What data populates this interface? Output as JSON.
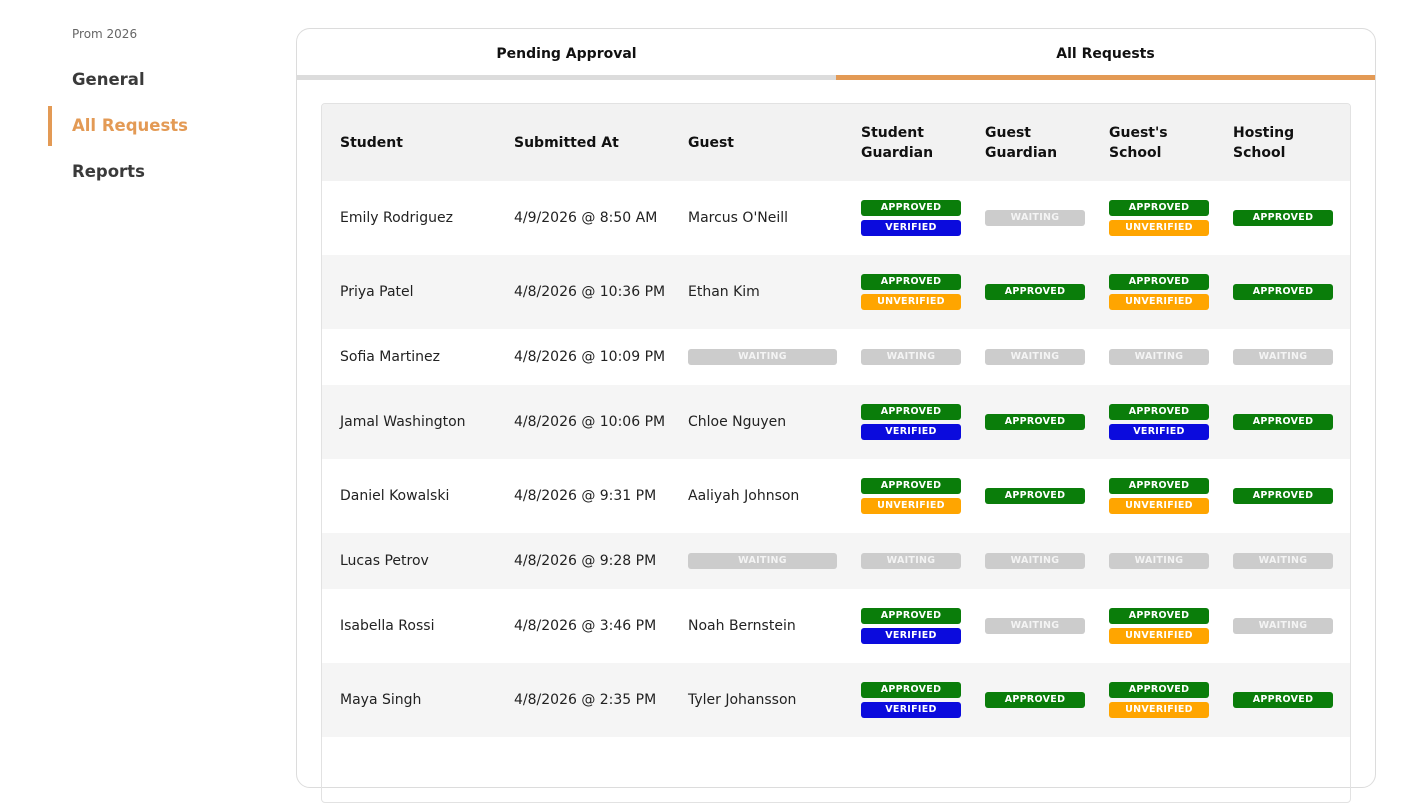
{
  "sidebar": {
    "event_name": "Prom 2026",
    "items": [
      {
        "label": "General",
        "active": false
      },
      {
        "label": "All Requests",
        "active": true
      },
      {
        "label": "Reports",
        "active": false
      }
    ]
  },
  "tabs": [
    {
      "label": "Pending Approval",
      "active": false
    },
    {
      "label": "All Requests",
      "active": true
    }
  ],
  "colors": {
    "accent": "#e39a55",
    "approved": "#0a7d0a",
    "waiting": "#cccccc",
    "verified": "#0b0bdd",
    "unverified": "#ffa500"
  },
  "table": {
    "headers": [
      "Student",
      "Submitted At",
      "Guest",
      "Student Guardian",
      "Guest Guardian",
      "Guest's School",
      "Hosting School"
    ],
    "rows": [
      {
        "student": "Emily Rodriguez",
        "submitted_at": "4/9/2026 @ 8:50 AM",
        "guest": "Marcus O'Neill",
        "student_guardian": [
          "APPROVED",
          "VERIFIED"
        ],
        "guest_guardian": [
          "WAITING"
        ],
        "guests_school": [
          "APPROVED",
          "UNVERIFIED"
        ],
        "hosting_school": [
          "APPROVED"
        ]
      },
      {
        "student": "Priya Patel",
        "submitted_at": "4/8/2026 @ 10:36 PM",
        "guest": "Ethan Kim",
        "student_guardian": [
          "APPROVED",
          "UNVERIFIED"
        ],
        "guest_guardian": [
          "APPROVED"
        ],
        "guests_school": [
          "APPROVED",
          "UNVERIFIED"
        ],
        "hosting_school": [
          "APPROVED"
        ]
      },
      {
        "student": "Sofia Martinez",
        "submitted_at": "4/8/2026 @ 10:09 PM",
        "guest": "WAITING",
        "student_guardian": [
          "WAITING"
        ],
        "guest_guardian": [
          "WAITING"
        ],
        "guests_school": [
          "WAITING"
        ],
        "hosting_school": [
          "WAITING"
        ]
      },
      {
        "student": "Jamal Washington",
        "submitted_at": "4/8/2026 @ 10:06 PM",
        "guest": "Chloe Nguyen",
        "student_guardian": [
          "APPROVED",
          "VERIFIED"
        ],
        "guest_guardian": [
          "APPROVED"
        ],
        "guests_school": [
          "APPROVED",
          "VERIFIED"
        ],
        "hosting_school": [
          "APPROVED"
        ]
      },
      {
        "student": "Daniel Kowalski",
        "submitted_at": "4/8/2026 @ 9:31 PM",
        "guest": "Aaliyah Johnson",
        "student_guardian": [
          "APPROVED",
          "UNVERIFIED"
        ],
        "guest_guardian": [
          "APPROVED"
        ],
        "guests_school": [
          "APPROVED",
          "UNVERIFIED"
        ],
        "hosting_school": [
          "APPROVED"
        ]
      },
      {
        "student": "Lucas Petrov",
        "submitted_at": "4/8/2026 @ 9:28 PM",
        "guest": "WAITING",
        "student_guardian": [
          "WAITING"
        ],
        "guest_guardian": [
          "WAITING"
        ],
        "guests_school": [
          "WAITING"
        ],
        "hosting_school": [
          "WAITING"
        ]
      },
      {
        "student": "Isabella Rossi",
        "submitted_at": "4/8/2026 @ 3:46 PM",
        "guest": "Noah Bernstein",
        "student_guardian": [
          "APPROVED",
          "VERIFIED"
        ],
        "guest_guardian": [
          "WAITING"
        ],
        "guests_school": [
          "APPROVED",
          "UNVERIFIED"
        ],
        "hosting_school": [
          "WAITING"
        ]
      },
      {
        "student": "Maya Singh",
        "submitted_at": "4/8/2026 @ 2:35 PM",
        "guest": "Tyler Johansson",
        "student_guardian": [
          "APPROVED",
          "VERIFIED"
        ],
        "guest_guardian": [
          "APPROVED"
        ],
        "guests_school": [
          "APPROVED",
          "UNVERIFIED"
        ],
        "hosting_school": [
          "APPROVED"
        ]
      }
    ]
  }
}
